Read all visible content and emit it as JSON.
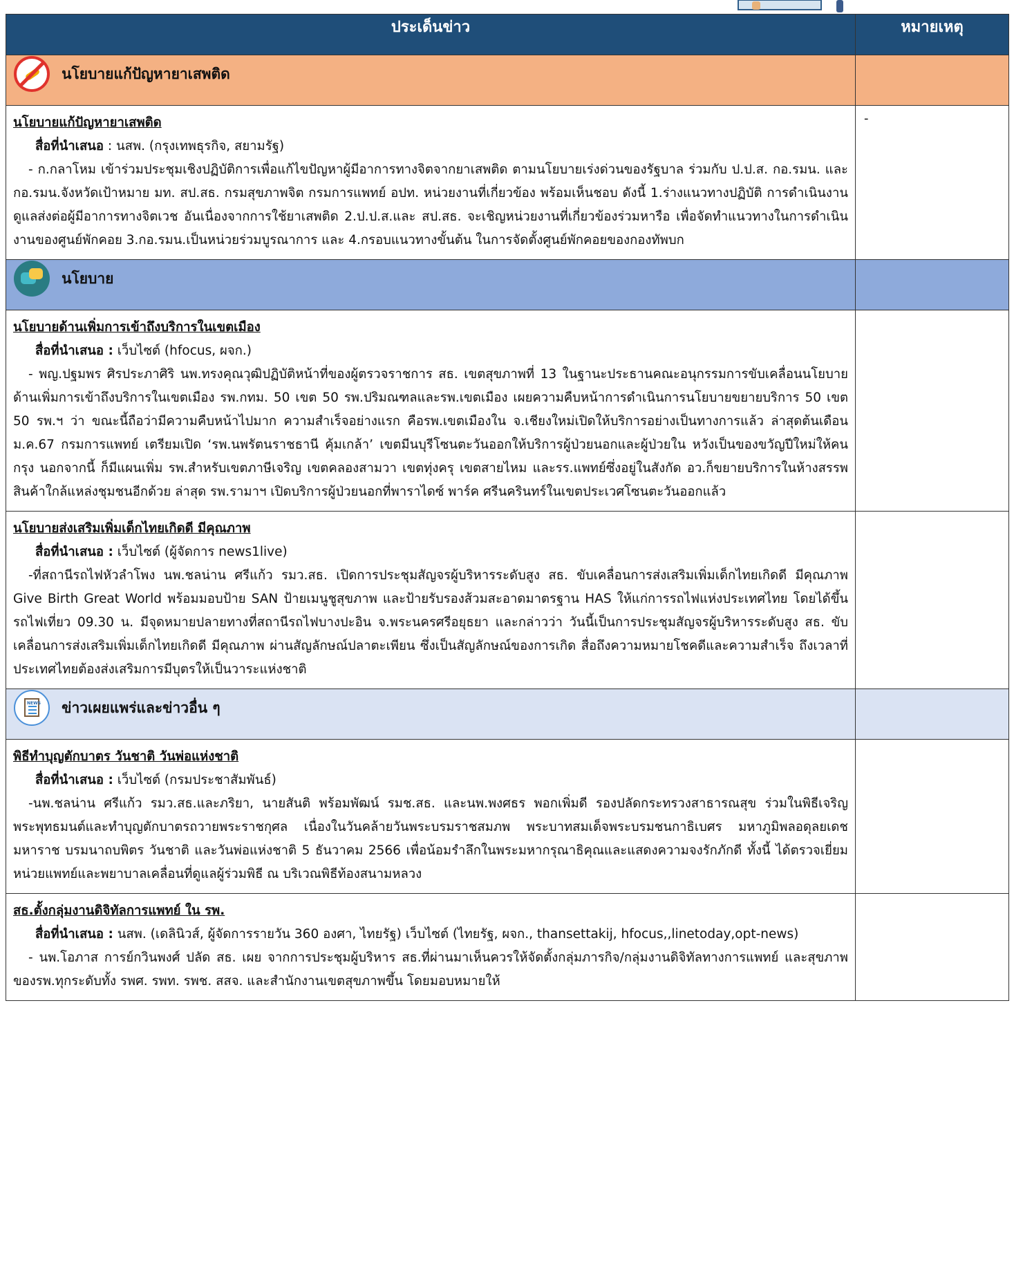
{
  "header": {
    "main_col": "ประเด็นข่าว",
    "note_col": "หมายเหตุ"
  },
  "sections": [
    {
      "category": "นโยบายแก้ปัญหายาเสพติด",
      "icon": "no-drug-icon",
      "items": [
        {
          "title": "นโยบายแก้ปัญหายาเสพติด",
          "source_label": "สื่อที่นำเสนอ",
          "source": " : นสพ. (กรุงเทพธุรกิจ, สยามรัฐ)",
          "body": "- ก.กลาโหม เข้าร่วมประชุมเชิงปฏิบัติการเพื่อแก้ไขปัญหาผู้มีอาการทางจิตจากยาเสพติด ตามนโยบายเร่งด่วนของรัฐบาล ร่วมกับ ป.ป.ส. กอ.รมน. และ กอ.รมน.จังหวัดเป้าหมาย มท. สป.สธ. กรมสุขภาพจิต กรมการแพทย์ อปท. หน่วยงานที่เกี่ยวข้อง พร้อมเห็นชอบ ดังนี้ 1.ร่างแนวทางปฏิบัติ การดำเนินงานดูแลส่งต่อผู้มีอาการทางจิตเวช อันเนื่องจากการใช้ยาเสพติด 2.ป.ป.ส.และ สป.สธ. จะเชิญหน่วยงานที่เกี่ยวข้องร่วมหารือ เพื่อจัดทำแนวทางในการดำเนินงานของศูนย์พักคอย 3.กอ.รมน.เป็นหน่วยร่วมบูรณาการ และ 4.กรอบแนวทางขั้นต้น ในการจัดตั้งศูนย์พักคอยของกองทัพบก",
          "note": "-"
        }
      ]
    },
    {
      "category": "นโยบาย",
      "icon": "chat-bubbles-icon",
      "items": [
        {
          "title": "นโยบายด้านเพิ่มการเข้าถึงบริการในเขตเมือง",
          "source_label": "สื่อที่นำเสนอ :",
          "source": " เว็บไซต์ (hfocus, ผจก.)",
          "body": "- พญ.ปฐมพร ศิรประภาศิริ นพ.ทรงคุณวุฒิปฏิบัติหน้าที่ของผู้ตรวจราชการ สธ. เขตสุขภาพที่ 13 ในฐานะประธานคณะอนุกรรมการขับเคลื่อนนโยบายด้านเพิ่มการเข้าถึงบริการในเขตเมือง รพ.กทม. 50 เขต 50 รพ.ปริมณฑลและรพ.เขตเมือง เผยความคืบหน้าการดำเนินการนโยบายขยายบริการ 50 เขต 50 รพ.ฯ ว่า ขณะนี้ถือว่ามีความคืบหน้าไปมาก ความสำเร็จอย่างแรก คือรพ.เขตเมืองใน จ.เชียงใหม่เปิดให้บริการอย่างเป็นทางการแล้ว ล่าสุดต้นเดือน ม.ค.67 กรมการแพทย์ เตรียมเปิด ‘รพ.นพรัตนราชธานี คุ้มเกล้า’ เขตมีนบุรีโซนตะวันออกให้บริการผู้ป่วยนอกและผู้ป่วยใน หวังเป็นของขวัญปีใหม่ให้คนกรุง นอกจากนี้ ก็มีแผนเพิ่ม รพ.สำหรับเขตภาษีเจริญ เขตคลองสามวา เขตทุ่งครุ เขตสายไหม และรร.แพทย์ซึ่งอยู่ในสังกัด อว.ก็ขยายบริการในห้างสรรพสินค้าใกล้แหล่งชุมชนอีกด้วย ล่าสุด รพ.รามาฯ เปิดบริการผู้ป่วยนอกที่พาราไดซ์ พาร์ค ศรีนครินทร์ในเขตประเวศโซนตะวันออกแล้ว",
          "note": ""
        },
        {
          "title": "นโยบายส่งเสริมเพิ่มเด็กไทยเกิดดี มีคุณภาพ",
          "source_label": "สื่อที่นำเสนอ :",
          "source": " เว็บไซต์ (ผู้จัดการ news1live)",
          "body": "-ที่สถานีรถไฟหัวลำโพง นพ.ชลน่าน ศรีแก้ว รมว.สธ. เปิดการประชุมสัญจรผู้บริหารระดับสูง สธ. ขับเคลื่อนการส่งเสริมเพิ่มเด็กไทยเกิดดี มีคุณภาพ Give Birth Great World พร้อมมอบป้าย SAN ป้ายเมนูชูสุขภาพ และป้ายรับรองส้วมสะอาดมาตรฐาน HAS ให้แก่การรถไฟแห่งประเทศไทย โดยได้ขึ้นรถไฟเที่ยว 09.30 น. มีจุดหมายปลายทางที่สถานีรถไฟบางปะอิน จ.พระนครศรีอยุธยา และกล่าวว่า วันนี้เป็นการประชุมสัญจรผู้บริหารระดับสูง สธ. ขับเคลื่อนการส่งเสริมเพิ่มเด็กไทยเกิดดี มีคุณภาพ ผ่านสัญลักษณ์ปลาตะเพียน ซึ่งเป็นสัญลักษณ์ของการเกิด สื่อถึงความหมายโชคดีและความสำเร็จ ถึงเวลาที่ประเทศไทยต้องส่งเสริมการมีบุตรให้เป็นวาระแห่งชาติ",
          "note": ""
        }
      ]
    },
    {
      "category": "ข่าวเผยแพร่และข่าวอื่น ๆ",
      "icon": "newspaper-icon",
      "items": [
        {
          "title": "พิธีทำบุญตักบาตร วันชาติ วันพ่อแห่งชาติ",
          "source_label": "สื่อที่นำเสนอ :",
          "source": " เว็บไซต์ (กรมประชาสัมพันธ์)",
          "body": "-นพ.ชลน่าน ศรีแก้ว รมว.สธ.และภริยา, นายสันติ พร้อมพัฒน์ รมช.สธ. และนพ.พงศธร พอกเพิ่มดี รองปลัดกระทรวงสาธารณสุข ร่วมในพิธีเจริญพระพุทธมนต์และทำบุญตักบาตรถวายพระราชกุศล เนื่องในวันคล้ายวันพระบรมราชสมภพ พระบาทสมเด็จพระบรมชนกาธิเบศร มหาภูมิพลอดุลยเดชมหาราช บรมนาถบพิตร วันชาติ และวันพ่อแห่งชาติ 5 ธันวาคม 2566 เพื่อน้อมรำลึกในพระมหากรุณาธิคุณและแสดงความจงรักภักดี ทั้งนี้ ได้ตรวจเยี่ยมหน่วยแพทย์และพยาบาลเคลื่อนที่ดูแลผู้ร่วมพิธี ณ บริเวณพิธีท้องสนามหลวง",
          "note": ""
        },
        {
          "title": "สธ.ตั้งกลุ่มงานดิจิทัลการแพทย์ ใน รพ.",
          "source_label": "สื่อที่นำเสนอ :",
          "source": " นสพ. (เดลินิวส์, ผู้จัดการรายวัน 360 องศา, ไทยรัฐ) เว็บไซต์ (ไทยรัฐ, ผจก., thansettakij, hfocus,,linetoday,opt-news)",
          "body": "- นพ.โอภาส การย์กวินพงศ์ ปลัด สธ. เผย จากการประชุมผู้บริหาร สธ.ที่ผ่านมาเห็นควรให้จัดตั้งกลุ่มภารกิจ/กลุ่มงานดิจิทัลทางการแพทย์ และสุขภาพของรพ.ทุกระดับทั้ง รพศ. รพท. รพช. สสจ. และสำนักงานเขตสุขภาพขึ้น โดยมอบหมายให้",
          "note": ""
        }
      ]
    }
  ]
}
